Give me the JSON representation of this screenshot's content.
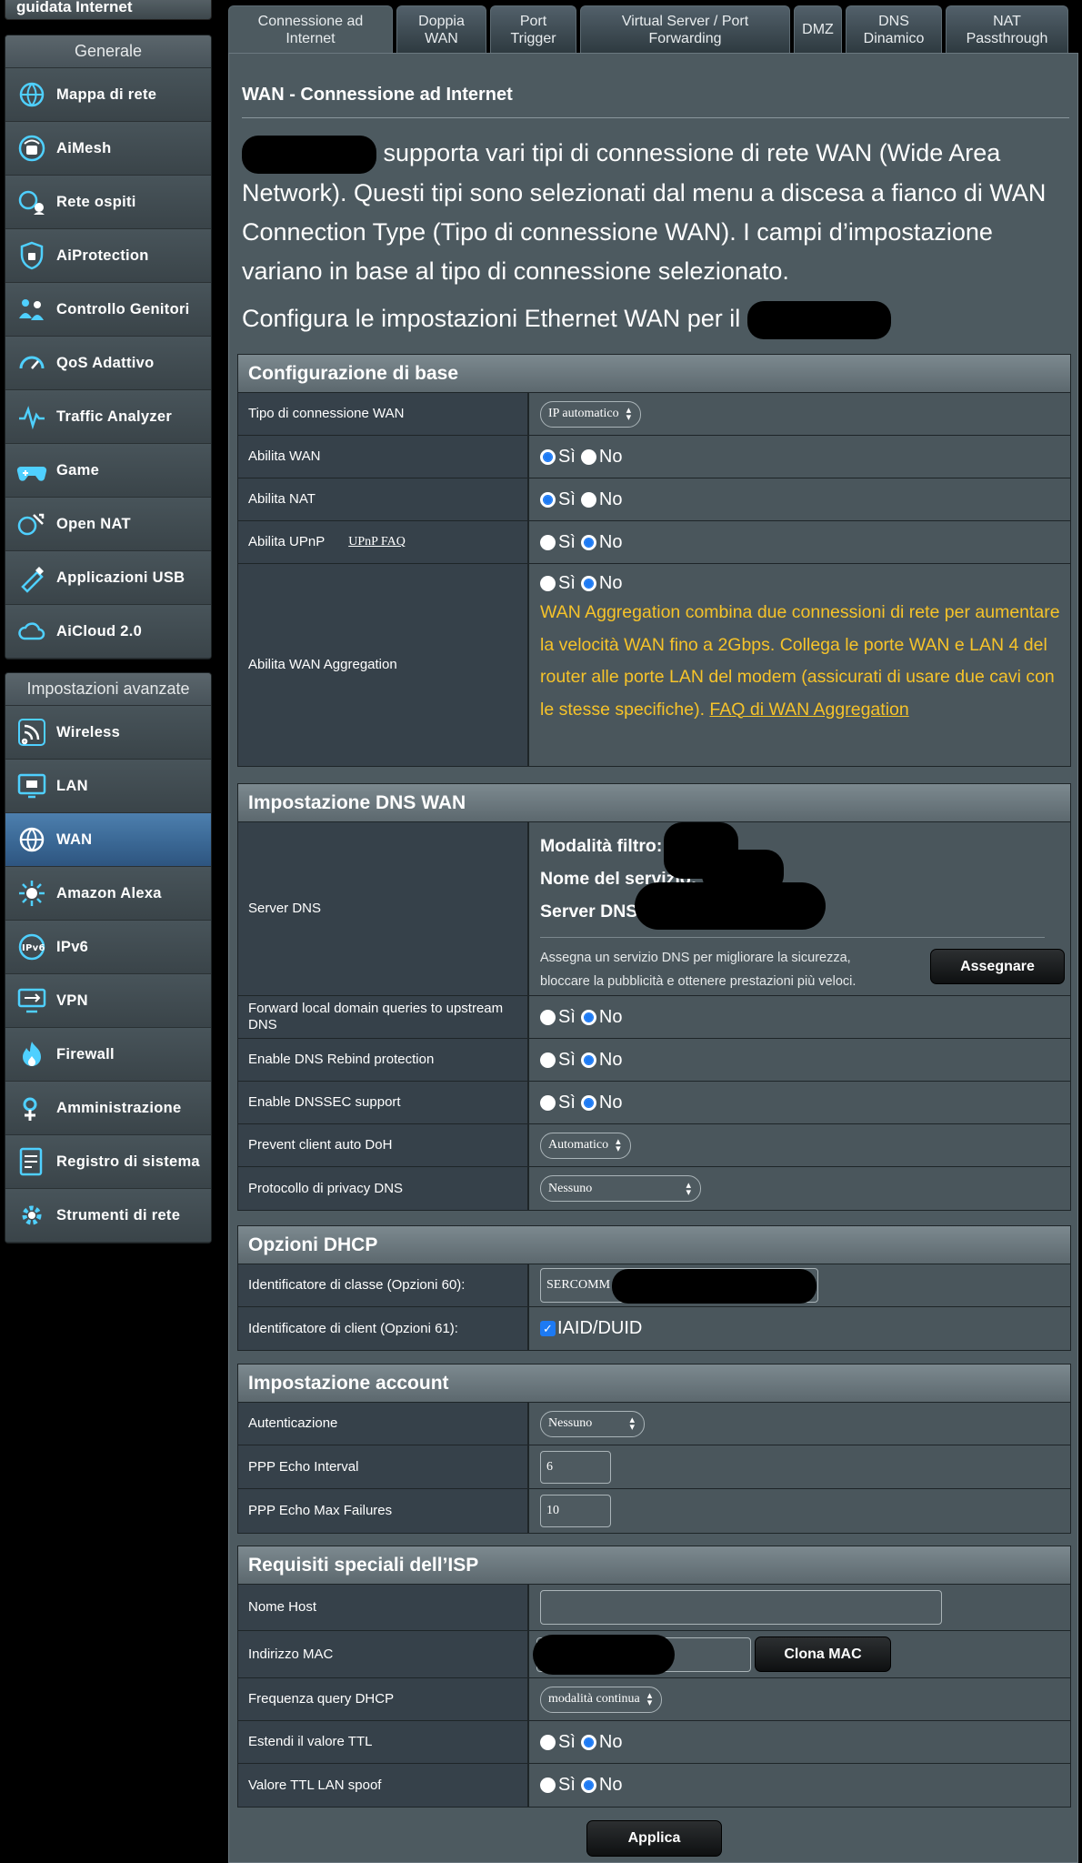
{
  "sidebar": {
    "top_item": "guidata Internet",
    "general_title": "Generale",
    "general_items": [
      {
        "label": "Mappa di rete",
        "icon": "network-map-icon"
      },
      {
        "label": "AiMesh",
        "icon": "aimesh-icon"
      },
      {
        "label": "Rete ospiti",
        "icon": "guest-network-icon"
      },
      {
        "label": "AiProtection",
        "icon": "shield-icon"
      },
      {
        "label": "Controllo Genitori",
        "icon": "parental-control-icon"
      },
      {
        "label": "QoS Adattivo",
        "icon": "qos-gauge-icon"
      },
      {
        "label": "Traffic Analyzer",
        "icon": "traffic-analyzer-icon"
      },
      {
        "label": "Game",
        "icon": "gamepad-icon"
      },
      {
        "label": "Open NAT",
        "icon": "open-nat-icon"
      },
      {
        "label": "Applicazioni USB",
        "icon": "usb-icon"
      },
      {
        "label": "AiCloud 2.0",
        "icon": "cloud-icon"
      }
    ],
    "advanced_title": "Impostazioni avanzate",
    "advanced_items": [
      {
        "label": "Wireless",
        "icon": "wireless-icon"
      },
      {
        "label": "LAN",
        "icon": "lan-icon"
      },
      {
        "label": "WAN",
        "icon": "globe-icon",
        "active": true
      },
      {
        "label": "Amazon Alexa",
        "icon": "alexa-icon"
      },
      {
        "label": "IPv6",
        "icon": "ipv6-icon"
      },
      {
        "label": "VPN",
        "icon": "vpn-icon"
      },
      {
        "label": "Firewall",
        "icon": "firewall-icon"
      },
      {
        "label": "Amministrazione",
        "icon": "administration-icon"
      },
      {
        "label": "Registro di sistema",
        "icon": "system-log-icon"
      },
      {
        "label": "Strumenti di rete",
        "icon": "network-tools-icon"
      }
    ]
  },
  "tabs": [
    {
      "label": "Connessione ad Internet",
      "active": true
    },
    {
      "label": "Doppia WAN"
    },
    {
      "label": "Port Trigger"
    },
    {
      "label": "Virtual Server / Port Forwarding"
    },
    {
      "label": "DMZ"
    },
    {
      "label": "DNS Dinamico"
    },
    {
      "label": "NAT Passthrough"
    }
  ],
  "page": {
    "title": "WAN - Connessione ad Internet",
    "intro": "supporta vari tipi di connessione di rete WAN (Wide Area Network). Questi tipi sono selezionati dal menu a discesa a fianco di WAN Connection Type (Tipo di connessione WAN). I campi d’impostazione variano in base al tipo di connessione selezionato.",
    "configure_text": "Configura le impostazioni Ethernet WAN per il"
  },
  "options": {
    "yes": "Sì",
    "no": "No"
  },
  "basic": {
    "title": "Configurazione di base",
    "wan_type_label": "Tipo di connessione WAN",
    "wan_type_value": "IP automatico",
    "enable_wan_label": "Abilita WAN",
    "enable_wan": "yes",
    "enable_nat_label": "Abilita NAT",
    "enable_nat": "yes",
    "enable_upnp_label": "Abilita UPnP",
    "upnp_faq": "UPnP FAQ",
    "enable_upnp": "no",
    "wan_agg_label": "Abilita WAN Aggregation",
    "wan_agg": "no",
    "wan_agg_note": "WAN Aggregation combina due connessioni di rete per aumentare la velocità WAN fino a 2Gbps. Collega le porte WAN e LAN 4 del router alle porte LAN del modem (assicurati di usare due cavi con le stesse specifiche).",
    "wan_agg_link": "FAQ di WAN Aggregation"
  },
  "dns": {
    "title": "Impostazione DNS WAN",
    "server_label": "Server DNS",
    "filter_mode": "Modalità filtro:",
    "service_name": "Nome del servizio:",
    "dns_server": "Server DNS:",
    "assign_note": "Assegna un servizio DNS per migliorare la sicurezza, bloccare la pubblicità e ottenere prestazioni più veloci.",
    "assign_button": "Assegnare",
    "forward_label": "Forward local domain queries to upstream DNS",
    "rebind_label": "Enable DNS Rebind protection",
    "dnssec_label": "Enable DNSSEC support",
    "doh_label": "Prevent client auto DoH",
    "doh_value": "Automatico",
    "privacy_label": "Protocollo di privacy DNS",
    "privacy_value": "Nessuno"
  },
  "dhcp": {
    "title": "Opzioni DHCP",
    "class_label": "Identificatore di classe (Opzioni 60):",
    "class_value": "SERCOMM",
    "client_label": "Identificatore di client (Opzioni 61):",
    "client_value": "IAID/DUID"
  },
  "account": {
    "title": "Impostazione account",
    "auth_label": "Autenticazione",
    "auth_value": "Nessuno",
    "echo_interval_label": "PPP Echo Interval",
    "echo_interval_value": "6",
    "echo_failures_label": "PPP Echo Max Failures",
    "echo_failures_value": "10"
  },
  "isp": {
    "title": "Requisiti speciali dell’ISP",
    "host_label": "Nome Host",
    "mac_label": "Indirizzo MAC",
    "clone_button": "Clona MAC",
    "dhcp_freq_label": "Frequenza query DHCP",
    "dhcp_freq_value": "modalità continua",
    "ttl_label": "Estendi il valore TTL",
    "ttl_spoof_label": "Valore TTL LAN spoof"
  },
  "apply_button": "Applica"
}
